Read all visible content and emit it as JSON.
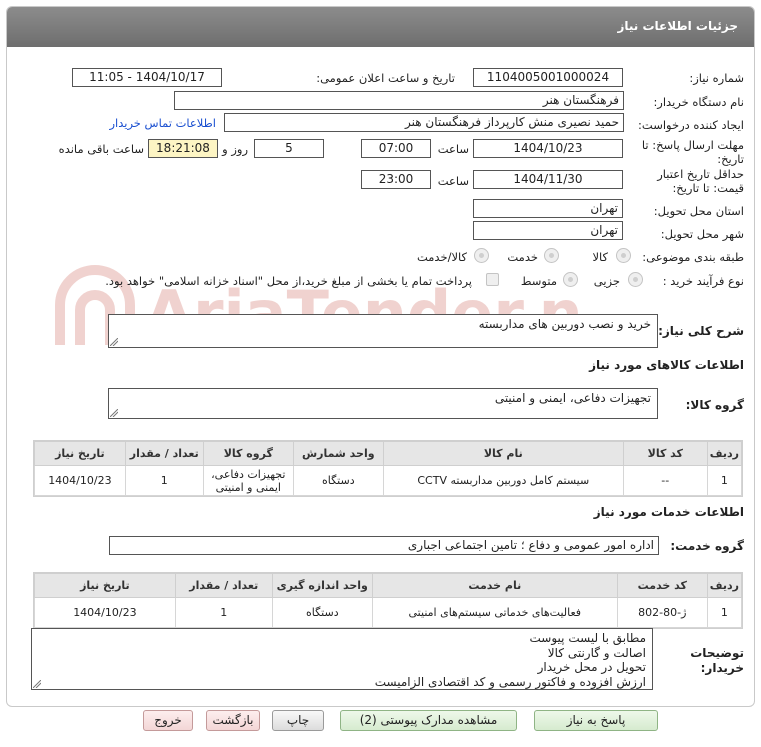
{
  "header": {
    "title": "جزئیات اطلاعات نیاز"
  },
  "form": {
    "need_number_label": "شماره نیاز:",
    "need_number": "1104005001000024",
    "announce_label": "تاریخ و ساعت اعلان عمومی:",
    "announce_value": "1404/10/17 - 11:05",
    "buyer_org_label": "نام دستگاه خریدار:",
    "buyer_org": "فرهنگستان هنر",
    "requester_label": "ایجاد کننده درخواست:",
    "requester": "حمید نصیری منش کارپرداز فرهنگستان هنر",
    "contact_link": "اطلاعات تماس خریدار",
    "deadline_label_1": "مهلت ارسال پاسخ: تا",
    "deadline_label_2": "تاریخ:",
    "deadline_date": "1404/10/23",
    "time_label": "ساعت",
    "deadline_time": "07:00",
    "days_value": "5",
    "days_label": "روز و",
    "remaining_time": "18:21:08",
    "remaining_label": "ساعت باقی مانده",
    "validity_label_1": "حداقل تاریخ اعتبار",
    "validity_label_2": "قیمت: تا تاریخ:",
    "validity_date": "1404/11/30",
    "validity_time": "23:00",
    "province_label": "استان محل تحویل:",
    "province": "تهران",
    "city_label": "شهر محل تحویل:",
    "city": "تهران",
    "category_label": "طبقه بندی موضوعی:",
    "category_options": [
      "کالا",
      "خدمت",
      "کالا/خدمت"
    ],
    "purchase_type_label": "نوع فرآیند خرید :",
    "purchase_options": [
      "جزیی",
      "متوسط"
    ],
    "purchase_note": "پرداخت تمام یا بخشی از مبلغ خرید،از محل \"اسناد خزانه اسلامی\" خواهد بود."
  },
  "description": {
    "label": "شرح کلی نیاز:",
    "value": "خرید و نصب دوربین های مداربسته"
  },
  "goods": {
    "section_title": "اطلاعات کالاهای مورد نیاز",
    "group_label": "گروه کالا:",
    "group_value": "تجهیزات دفاعی، ایمنی و امنیتی",
    "columns": [
      "ردیف",
      "کد کالا",
      "نام کالا",
      "واحد شمارش",
      "گروه کالا",
      "تعداد / مقدار",
      "تاریخ نیاز"
    ],
    "rows": [
      {
        "row": "1",
        "code": "--",
        "name": "سیستم کامل دوربین مداربسته CCTV",
        "unit": "دستگاه",
        "group": "تجهیزات دفاعی، ایمنی و امنیتی",
        "qty": "1",
        "date": "1404/10/23"
      }
    ]
  },
  "services": {
    "section_title": "اطلاعات خدمات مورد نیاز",
    "group_label": "گروه خدمت:",
    "group_value": "اداره امور عمومی و دفاع ؛ تامین اجتماعی اجباری",
    "columns": [
      "ردیف",
      "کد خدمت",
      "نام خدمت",
      "واحد اندازه گیری",
      "تعداد / مقدار",
      "تاریخ نیاز"
    ],
    "rows": [
      {
        "row": "1",
        "code": "ژ-80-802",
        "name": "فعالیت‌های خدماتی سیستم‌های امنیتی",
        "unit": "دستگاه",
        "qty": "1",
        "date": "1404/10/23"
      }
    ]
  },
  "buyer_notes": {
    "label_1": "توضیحات",
    "label_2": "خریدار:",
    "lines": [
      "مطابق با لیست پیوست",
      "اصالت و گارنتی کالا",
      "تحویل در محل خریدار",
      "ارزش افزوده و فاکتور رسمی و کد اقتصادی الزامیست"
    ]
  },
  "buttons": {
    "reply": "پاسخ به نیاز",
    "view_docs": "مشاهده مدارک پیوستی (2)",
    "print": "چاپ",
    "back": "بازگشت",
    "exit": "خروج"
  },
  "watermark": {
    "text": "AriaTender.net"
  },
  "colors": {
    "header": "#7a7a7a",
    "link": "#1a4fd0",
    "remaining_bg": "#fdf5c4",
    "watermark": "#c0392b"
  }
}
